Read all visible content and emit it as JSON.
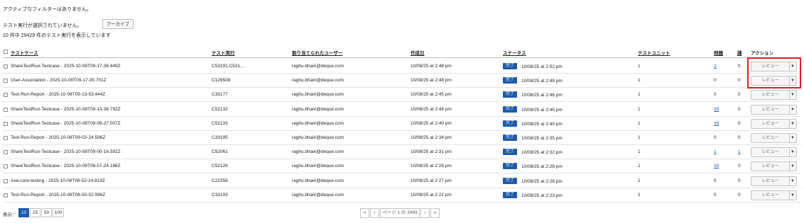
{
  "status": {
    "no_filters": "アクティブなフィルターはありません。",
    "none_selected": "テスト実行が選択されていません。",
    "archive_button": "アーカイブ",
    "showing": "10 件中 29429 件のテスト実行を表示しています"
  },
  "table": {
    "headers": {
      "test_case": "テストケース",
      "test_run": "テスト実行",
      "assigned_user": "割り当てられたユーザー",
      "created": "作成日",
      "status": "ステータス",
      "test_unit": "テストユニット",
      "issues": "問題",
      "bugs": "課",
      "actions": "アクション"
    },
    "rows": [
      {
        "name": "ShareTestRun-Testcase - 2025-10-08T09-17-36.449Z",
        "run": "C53191,C531...",
        "user": "raghu.bhairi@deque.com",
        "created": "10/08/25 at 2:48 pm",
        "status_badge": "完了",
        "status_time": "10/08/25 at 2:52 pm",
        "unit": "1",
        "issues": "3",
        "bugs": "0",
        "action": "レビュー"
      },
      {
        "name": "User-Association - 2025-10-08T09-17-35.701Z",
        "run": "C126508",
        "user": "raghu.bhairi@deque.com",
        "created": "10/08/25 at 2:48 pm",
        "status_badge": "完了",
        "status_time": "10/08/25 at 2:49 pm",
        "unit": "1",
        "issues": "0",
        "bugs": "0",
        "action": "レビュー"
      },
      {
        "name": "Test-Run-Report - 2025-10-08T09-13-53.444Z",
        "run": "C33177",
        "user": "raghu.bhairi@deque.com",
        "created": "10/08/25 at 2:45 pm",
        "status_badge": "完了",
        "status_time": "10/08/25 at 2:46 pm",
        "unit": "1",
        "issues": "0",
        "bugs": "0",
        "action": "レビュー"
      },
      {
        "name": "ShareTestRun-Testcase - 2025-10-08T09-13-38.792Z",
        "run": "C52132",
        "user": "raghu.bhairi@deque.com",
        "created": "10/08/25 at 2:44 pm",
        "status_badge": "完了",
        "status_time": "10/08/25 at 2:45 pm",
        "unit": "1",
        "issues": "39",
        "bugs": "0",
        "action": "レビュー"
      },
      {
        "name": "ShareTestRun-Testcase - 2025-10-08T09-09-27.007Z",
        "run": "C52133",
        "user": "raghu.bhairi@deque.com",
        "created": "10/08/25 at 2:40 pm",
        "status_badge": "完了",
        "status_time": "10/08/25 at 2:40 pm",
        "unit": "1",
        "issues": "39",
        "bugs": "0",
        "action": "レビュー"
      },
      {
        "name": "Test-Run-Report - 2025-10-08T09-02-24.596Z",
        "run": "C33195",
        "user": "raghu.bhairi@deque.com",
        "created": "10/08/25 at 2:34 pm",
        "status_badge": "完了",
        "status_time": "10/08/25 at 2:35 pm",
        "unit": "1",
        "issues": "0",
        "bugs": "0",
        "action": "レビュー"
      },
      {
        "name": "ShareTestRun-Testcase - 2025-10-08T09-00-16.592Z",
        "run": "C52061",
        "user": "raghu.bhairi@deque.com",
        "created": "10/08/25 at 2:31 pm",
        "status_badge": "完了",
        "status_time": "10/08/25 at 2:32 pm",
        "unit": "1",
        "issues": "1",
        "bugs": "1",
        "action": "レビュー"
      },
      {
        "name": "ShareTestRun-Testcase - 2025-10-08T08-57-24.186Z",
        "run": "C52126",
        "user": "raghu.bhairi@deque.com",
        "created": "10/08/25 at 2:28 pm",
        "status_badge": "完了",
        "status_time": "10/08/25 at 2:28 pm",
        "unit": "1",
        "issues": "39",
        "bugs": "0",
        "action": "レビュー"
      },
      {
        "name": "Axe-core-testing - 2025-10-08T08-52-24.819Z",
        "run": "C22358",
        "user": "raghu.bhairi@deque.com",
        "created": "10/08/25 at 2:27 pm",
        "status_badge": "完了",
        "status_time": "10/08/25 at 2:28 pm",
        "unit": "1",
        "issues": "0",
        "bugs": "0",
        "action": "レビュー"
      },
      {
        "name": "Test-Run-Report - 2025-10-08T08-50-52.996Z",
        "run": "C33193",
        "user": "raghu.bhairi@deque.com",
        "created": "10/08/25 at 2:22 pm",
        "status_badge": "完了",
        "status_time": "10/08/25 at 2:23 pm",
        "unit": "1",
        "issues": "0",
        "bugs": "0",
        "action": "レビュー"
      }
    ]
  },
  "footer": {
    "display_label": "表示：",
    "page_sizes": [
      "10",
      "25",
      "50",
      "100"
    ],
    "pager": {
      "first": "«",
      "prev": "‹",
      "page_info": "ページ 1 の 2943",
      "next": "›",
      "last": "»"
    }
  },
  "icons": {
    "checkbox": "checkbox-icon",
    "caret": "caret-down-icon"
  },
  "colors": {
    "badge": "#1e5aa8",
    "link": "#1f5fbf",
    "highlight": "#d42121"
  }
}
